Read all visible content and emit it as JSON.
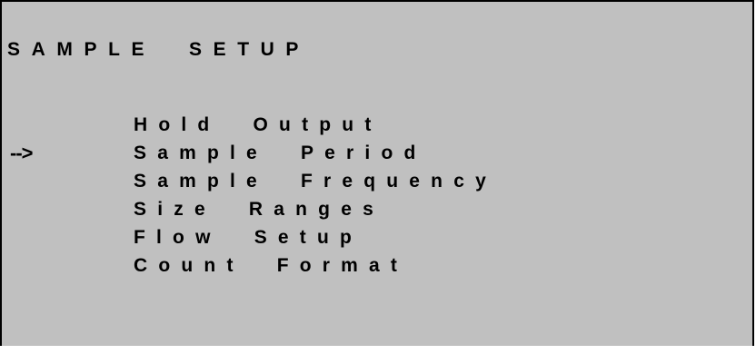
{
  "screen": {
    "title": "SAMPLE  SETUP",
    "cursor": "-->",
    "selected_index": 1,
    "menu": [
      {
        "label": "Hold  Output"
      },
      {
        "label": "Sample  Period"
      },
      {
        "label": "Sample  Frequency"
      },
      {
        "label": "Size  Ranges"
      },
      {
        "label": "Flow  Setup"
      },
      {
        "label": "Count  Format"
      }
    ],
    "colors": {
      "background": "#c0c0c0",
      "text": "#000000",
      "border": "#000000"
    }
  }
}
